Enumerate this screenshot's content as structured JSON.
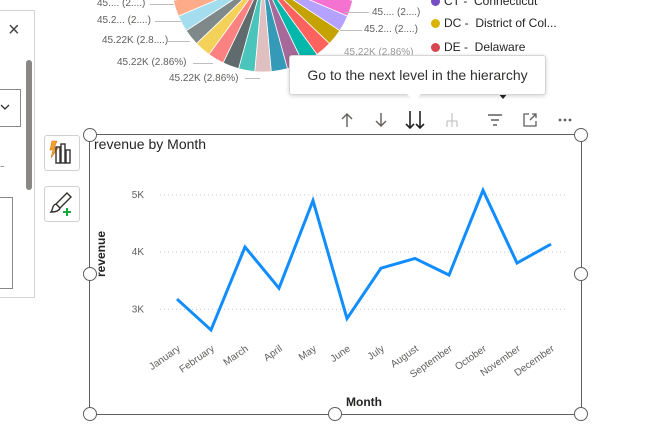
{
  "pie": {
    "labels": [
      "45.... (2....)",
      "45.2... (2....)",
      "45.22K (2.8....)",
      "45.22K (2.86%)",
      "45.22K (2.86%)",
      "45.... (2....)",
      "45.2... (2....)",
      "45.22K (2.86%)"
    ],
    "colors": [
      "#e044a7",
      "#744ec2",
      "#d9b300",
      "#d64550",
      "#197278",
      "#1aab40",
      "#15c6f4",
      "#4092ff",
      "#ffa058",
      "#be5dc9",
      "#f472d0",
      "#b5a1ff",
      "#c4a200",
      "#fd625e",
      "#01b8aa",
      "#a66999",
      "#3599b8",
      "#dfbfbf",
      "#4ac5bb",
      "#5f6b6d",
      "#fb8281",
      "#f4d25a",
      "#7f898a",
      "#a4ddee",
      "#fdab89",
      "#b687ac",
      "#28738a",
      "#a78f8f",
      "#168980",
      "#293537",
      "#12239e",
      "#e66c37",
      "#6b007b",
      "#ff6f00",
      "#118dff"
    ]
  },
  "legend": [
    {
      "code": "CT",
      "name": "Connecticut",
      "color": "#744ec2"
    },
    {
      "code": "DC",
      "name": "District of Col...",
      "color": "#d9b300"
    },
    {
      "code": "DE",
      "name": "Delaware",
      "color": "#d64550"
    }
  ],
  "tooltip": {
    "text": "Go to the next level in the hierarchy"
  },
  "toolbar": {
    "icons": [
      "drill-up-icon",
      "drill-down-icon",
      "expand-next-level-icon",
      "expand-all-icon",
      "filter-icon",
      "focus-mode-icon",
      "more-options-icon"
    ]
  },
  "left_panel": {
    "close_glyph": "×"
  },
  "chart_data": {
    "type": "line",
    "title": "revenue by Month",
    "xlabel": "Month",
    "ylabel": "revenue",
    "categories": [
      "January",
      "February",
      "March",
      "April",
      "May",
      "June",
      "July",
      "August",
      "September",
      "October",
      "November",
      "December"
    ],
    "series": [
      {
        "values": [
          3180,
          2640,
          4090,
          3370,
          4900,
          2840,
          3720,
          3890,
          3600,
          5080,
          3810,
          4140
        ]
      }
    ],
    "yticks": [
      "3K",
      "4K",
      "5K"
    ],
    "ytick_values": [
      3000,
      4000,
      5000
    ],
    "ylim": [
      2500,
      5400
    ],
    "grid": true,
    "line_color": "#118dff"
  }
}
